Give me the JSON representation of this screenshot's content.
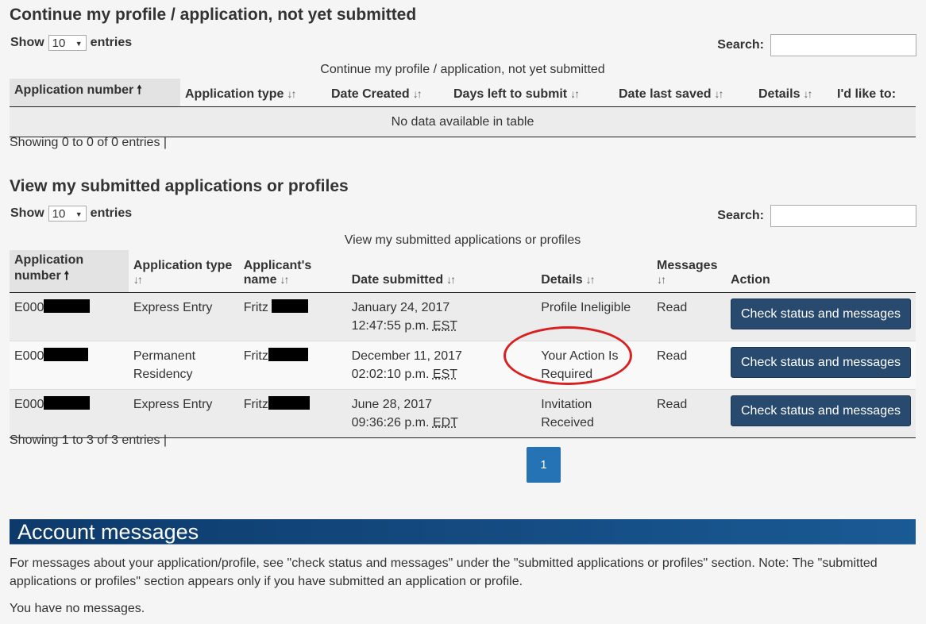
{
  "section1": {
    "title": "Continue my profile / application, not yet submitted",
    "show_label": "Show",
    "entries_value": "10",
    "entries_label": "entries",
    "search_label": "Search:",
    "caption": "Continue my profile / application, not yet submitted",
    "columns": [
      "Application number",
      "Application type",
      "Date Created",
      "Days left to submit",
      "Date last saved",
      "Details",
      "I'd like to:"
    ],
    "empty_message": "No data available in table",
    "info": "Showing 0 to 0 of 0 entries |"
  },
  "section2": {
    "title": "View my submitted applications or profiles",
    "show_label": "Show",
    "entries_value": "10",
    "entries_label": "entries",
    "search_label": "Search:",
    "caption": "View my submitted applications or profiles",
    "columns": {
      "app_number": "Application number",
      "app_type": "Application type",
      "applicant": "Applicant's name",
      "date": "Date submitted",
      "details": "Details",
      "messages": "Messages",
      "action": "Action"
    },
    "rows": [
      {
        "app_number": "E000",
        "app_type": "Express Entry",
        "applicant": "Fritz",
        "date": "January 24, 2017",
        "time": "12:47:55 p.m.",
        "tz": "EST",
        "details": "Profile Ineligible",
        "messages": "Read",
        "action": "Check status and messages"
      },
      {
        "app_number": "E000",
        "app_type": "Permanent Residency",
        "applicant": "Fritz",
        "date": "December 11, 2017",
        "time": "02:02:10 p.m.",
        "tz": "EST",
        "details": "Your Action Is Required",
        "messages": "Read",
        "action": "Check status and messages"
      },
      {
        "app_number": "E000",
        "app_type": "Express Entry",
        "applicant": "Fritz",
        "date": "June 28, 2017",
        "time": "09:36:26 p.m.",
        "tz": "EDT",
        "details": "Invitation Received",
        "messages": "Read",
        "action": "Check status and messages"
      }
    ],
    "info": "Showing 1 to 3 of 3 entries |",
    "current_page": "1"
  },
  "account": {
    "title": "Account messages",
    "note": "For messages about your application/profile, see \"check status and messages\" under the \"submitted applications or profiles\" section. Note: The \"submitted applications or profiles\" section appears only if you have submitted an application or profile.",
    "no_messages": "You have no messages."
  },
  "colors": {
    "button": "#284a6e",
    "pager": "#2572b4",
    "banner": "#0d3a6b",
    "highlight_circle": "#d92020"
  }
}
